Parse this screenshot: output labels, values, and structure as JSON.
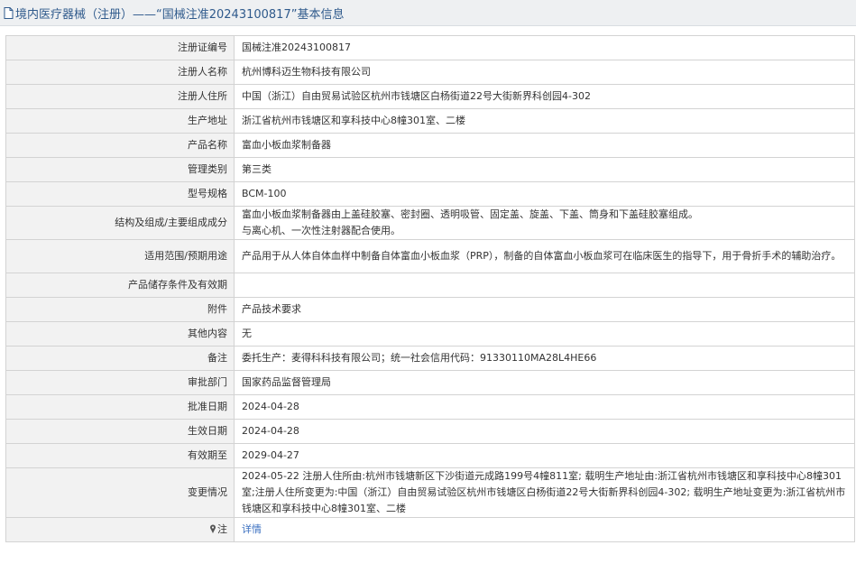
{
  "page": {
    "title": "境内医疗器械（注册）——“国械注准20243100817”基本信息"
  },
  "rows": [
    {
      "label": "注册证编号",
      "value": "国械注准20243100817"
    },
    {
      "label": "注册人名称",
      "value": "杭州博科迈生物科技有限公司"
    },
    {
      "label": "注册人住所",
      "value": "中国（浙江）自由贸易试验区杭州市钱塘区白杨街道22号大街新界科创园4-302"
    },
    {
      "label": "生产地址",
      "value": "浙江省杭州市钱塘区和享科技中心8幢301室、二楼"
    },
    {
      "label": "产品名称",
      "value": "富血小板血浆制备器"
    },
    {
      "label": "管理类别",
      "value": "第三类"
    },
    {
      "label": "型号规格",
      "value": "BCM-100"
    },
    {
      "label": "结构及组成/主要组成成分",
      "value": "富血小板血浆制备器由上盖硅胶塞、密封圈、透明吸管、固定盖、旋盖、下盖、筒身和下盖硅胶塞组成。",
      "value2": "与离心机、一次性注射器配合使用。"
    },
    {
      "label": "适用范围/预期用途",
      "value": "产品用于从人体自体血样中制备自体富血小板血浆（PRP），制备的自体富血小板血浆可在临床医生的指导下，用于骨折手术的辅助治疗。"
    },
    {
      "label": "产品储存条件及有效期",
      "value": ""
    },
    {
      "label": "附件",
      "value": "产品技术要求"
    },
    {
      "label": "其他内容",
      "value": "无"
    },
    {
      "label": "备注",
      "value": "委托生产：麦得科科技有限公司；统一社会信用代码：91330110MA28L4HE66"
    },
    {
      "label": "审批部门",
      "value": "国家药品监督管理局"
    },
    {
      "label": "批准日期",
      "value": "2024-04-28"
    },
    {
      "label": "生效日期",
      "value": "2024-04-28"
    },
    {
      "label": "有效期至",
      "value": "2029-04-27"
    },
    {
      "label": "变更情况",
      "value": "2024-05-22 注册人住所由:杭州市钱塘新区下沙街道元成路199号4幢811室; 载明生产地址由:浙江省杭州市钱塘区和享科技中心8幢301室;注册人住所变更为:中国（浙江）自由贸易试验区杭州市钱塘区白杨街道22号大街新界科创园4-302; 载明生产地址变更为:浙江省杭州市钱塘区和享科技中心8幢301室、二楼"
    },
    {
      "label": "注",
      "value": "详情"
    }
  ],
  "icons": {
    "title": "document-icon",
    "note": "map-pin-icon"
  }
}
